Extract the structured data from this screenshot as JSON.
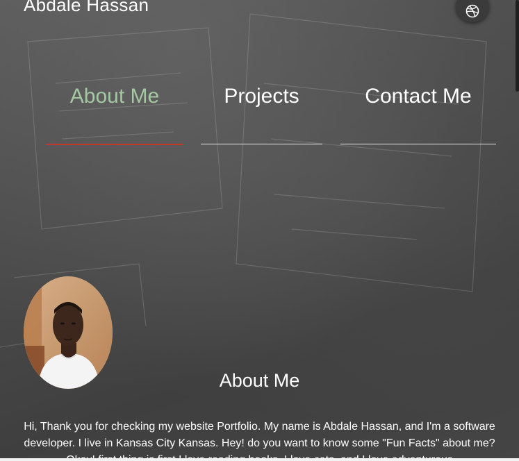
{
  "header": {
    "name": "Abdale Hassan",
    "social_icon": "dribbble-icon"
  },
  "nav": {
    "items": [
      {
        "label": "About Me",
        "active": true
      },
      {
        "label": "Projects",
        "active": false
      },
      {
        "label": "Contact Me",
        "active": false
      }
    ],
    "active_color": "#a4c8a2",
    "active_underline_color": "#c0392b"
  },
  "about": {
    "title": "About Me",
    "bio": "Hi, Thank you for checking my website Portfolio. My name is Abdale Hassan, and I'm a software developer. I live in Kansas City Kansas. Hey! do you want to know some \"Fun Facts\" about me? Okay! first thing is first I love reading books, I love cats, and I love adventurous"
  }
}
